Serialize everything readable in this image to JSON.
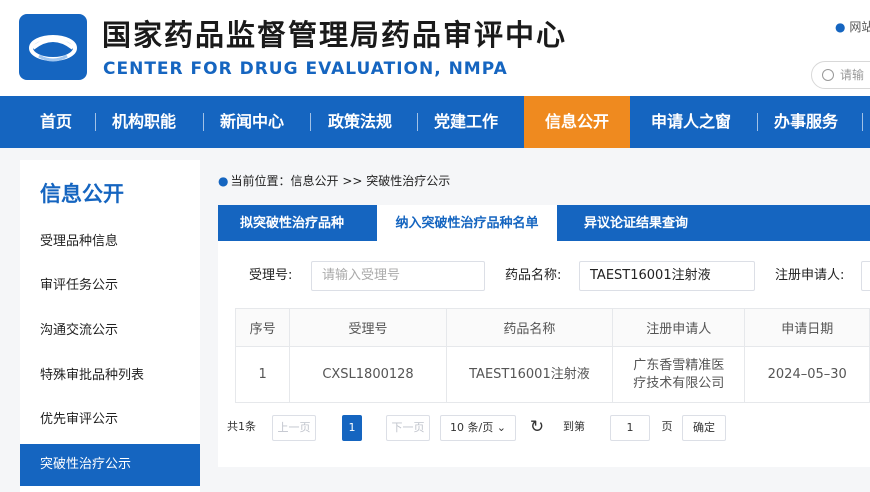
{
  "header": {
    "title_cn": "国家药品监督管理局药品审评中心",
    "title_en": "CENTER FOR DRUG EVALUATION, NMPA",
    "site_nav_label": "网站",
    "search_placeholder": "请输",
    "logo_icon": "cde-logo-icon",
    "pin_icon": "location-pin-icon",
    "search_icon": "search-icon"
  },
  "nav": {
    "items": [
      "首页",
      "机构职能",
      "新闻中心",
      "政策法规",
      "党建工作",
      "信息公开",
      "申请人之窗",
      "办事服务"
    ],
    "active": "信息公开"
  },
  "sidebar": {
    "title": "信息公开",
    "items": [
      "受理品种信息",
      "审评任务公示",
      "沟通交流公示",
      "特殊审批品种列表",
      "优先审评公示",
      "突破性治疗公示"
    ],
    "active": "突破性治疗公示"
  },
  "breadcrumb": {
    "prefix": "当前位置：",
    "path": "信息公开 >> 突破性治疗公示"
  },
  "tabs": {
    "items": [
      "拟突破性治疗品种",
      "纳入突破性治疗品种名单",
      "异议论证结果查询"
    ],
    "active": "纳入突破性治疗品种名单"
  },
  "filters": {
    "accept_no_label": "受理号:",
    "accept_no_placeholder": "请输入受理号",
    "drug_name_label": "药品名称:",
    "drug_name_value": "TAEST16001注射液",
    "applicant_label": "注册申请人:"
  },
  "table": {
    "columns": [
      "序号",
      "受理号",
      "药品名称",
      "注册申请人",
      "申请日期"
    ],
    "rows": [
      [
        "1",
        "CXSL1800128",
        "TAEST16001注射液",
        "广东香雪精准医疗技术有限公司",
        "2024–05–30"
      ]
    ]
  },
  "pager": {
    "total": "共1条",
    "prev": "上一页",
    "current_page": "1",
    "next": "下一页",
    "page_size": "10 条/页",
    "goto_label": "到第",
    "goto_value": "1",
    "page_unit": "页",
    "confirm": "确定"
  },
  "colors": {
    "brand_blue": "#1565c0",
    "active_orange": "#ef8a1f"
  }
}
